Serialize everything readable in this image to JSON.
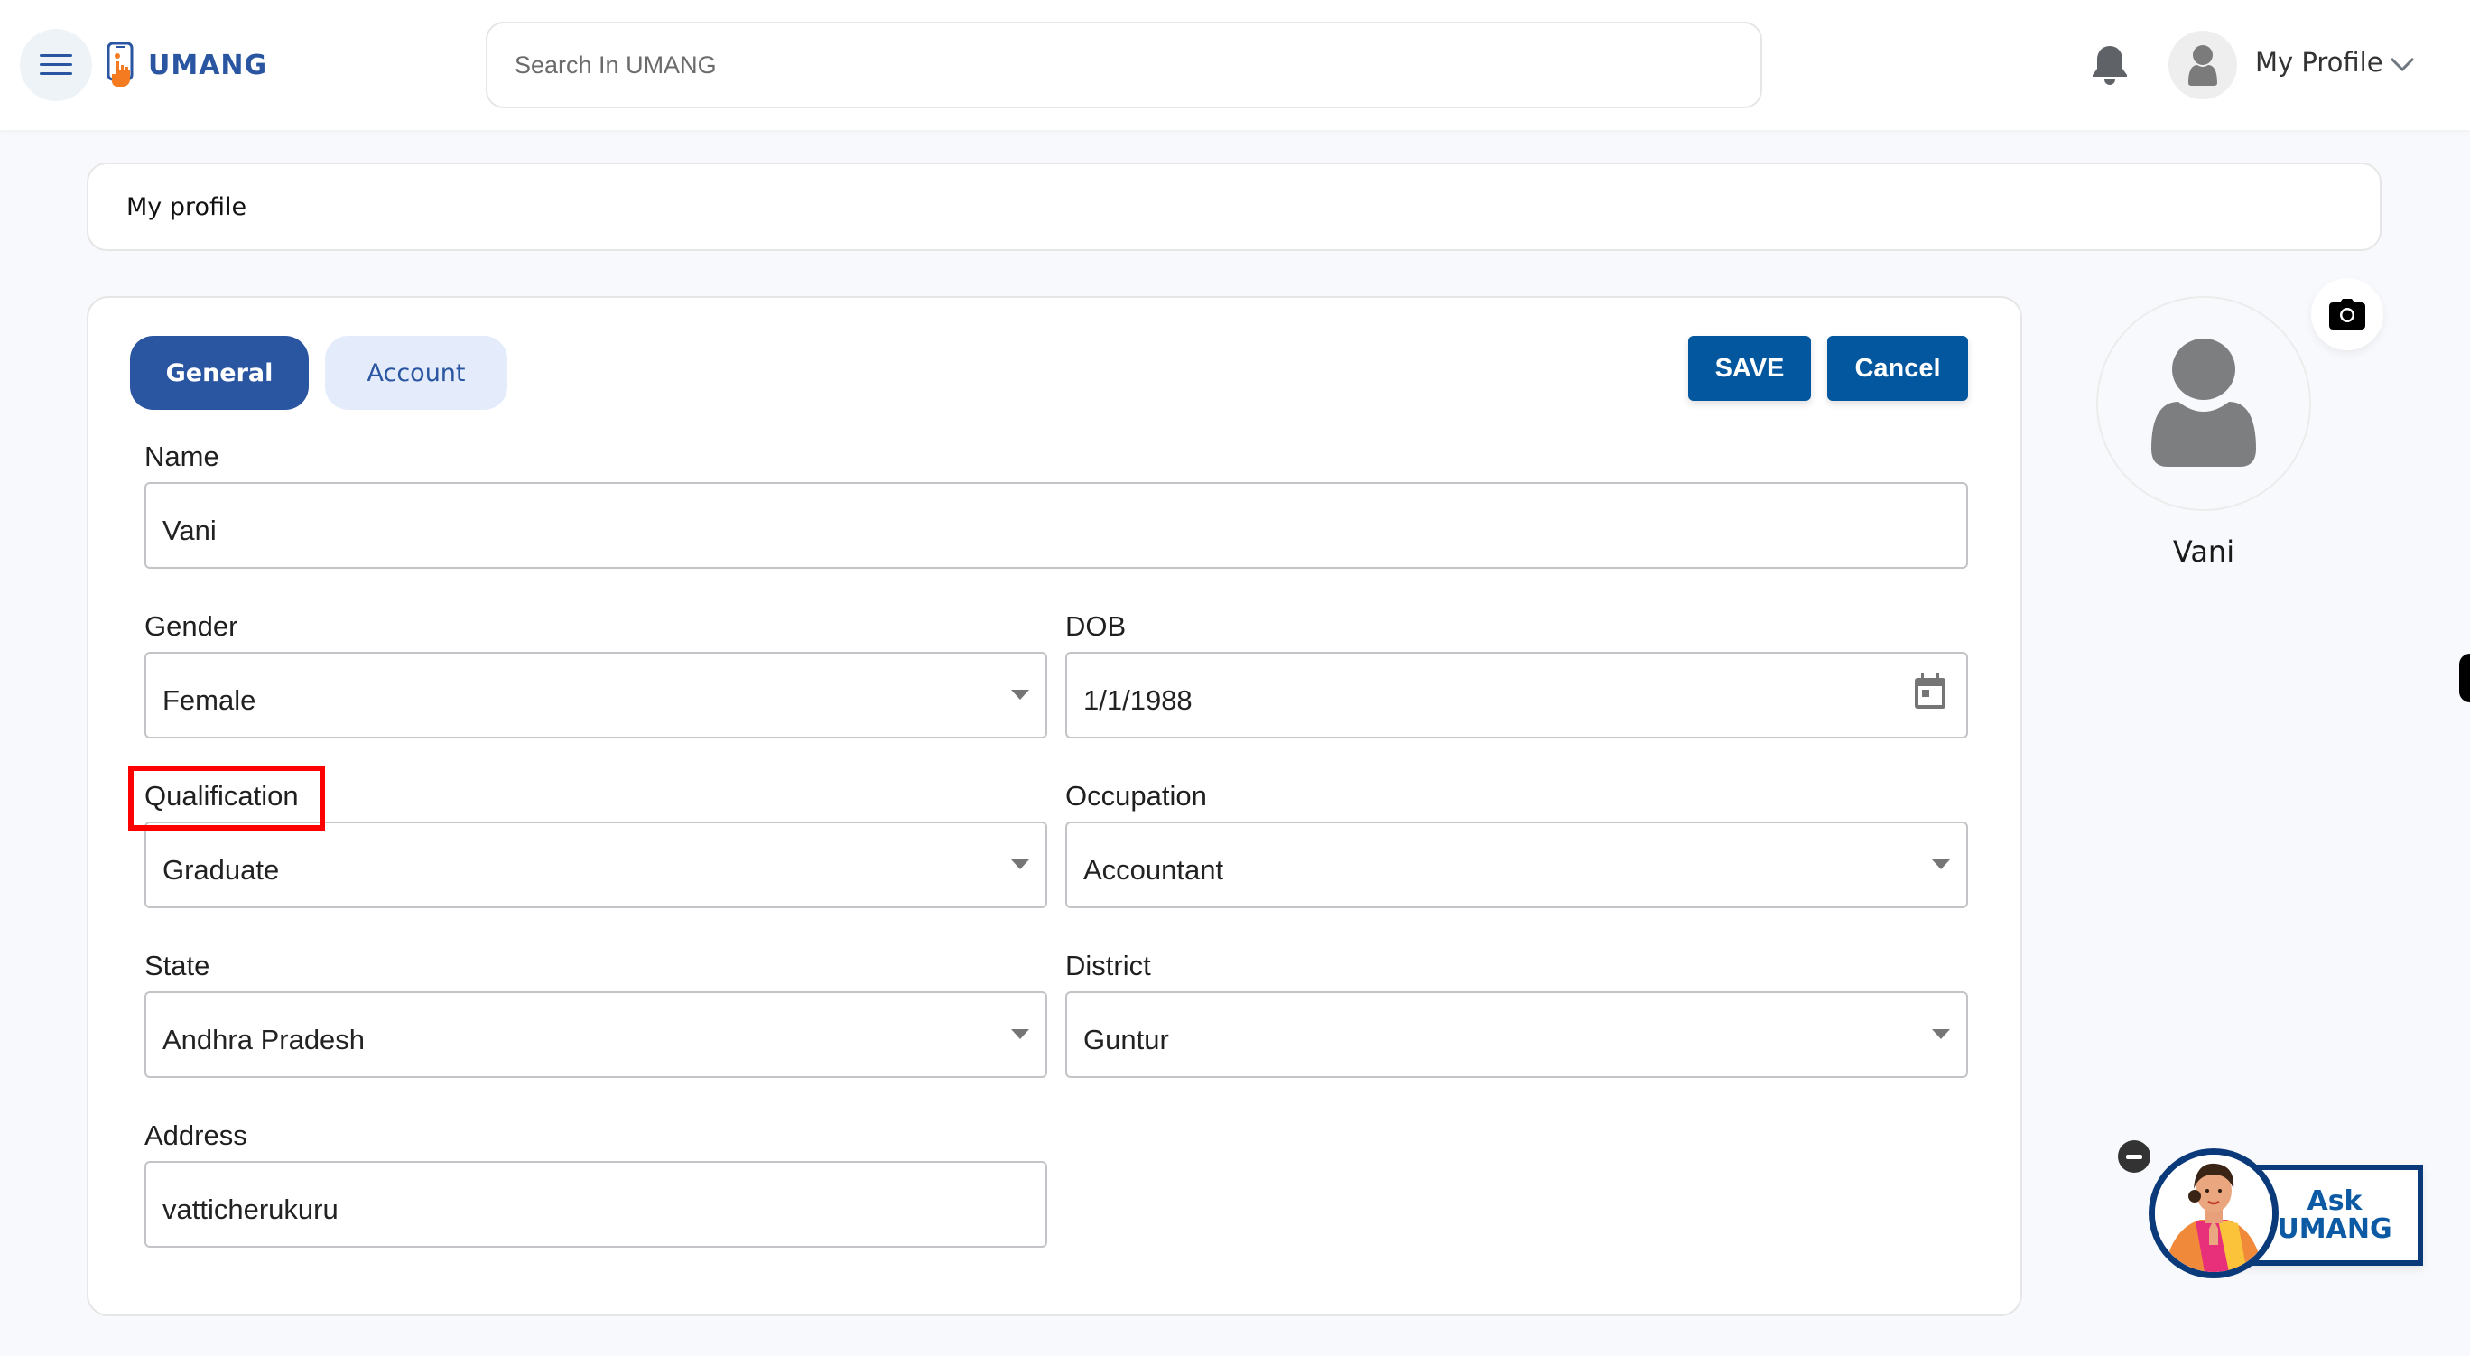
{
  "header": {
    "logo_text": "UMANG",
    "search_placeholder": "Search In UMANG",
    "search_value": "",
    "profile_label": "My Profile"
  },
  "breadcrumb": {
    "title": "My profile"
  },
  "tabs": [
    {
      "label": "General",
      "active": true
    },
    {
      "label": "Account",
      "active": false
    }
  ],
  "actions": {
    "save_label": "SAVE",
    "cancel_label": "Cancel"
  },
  "form": {
    "name": {
      "label": "Name",
      "value": "Vani"
    },
    "gender": {
      "label": "Gender",
      "value": "Female"
    },
    "dob": {
      "label": "DOB",
      "value": "1/1/1988"
    },
    "qualification": {
      "label": "Qualification",
      "value": "Graduate"
    },
    "occupation": {
      "label": "Occupation",
      "value": "Accountant"
    },
    "state": {
      "label": "State",
      "value": "Andhra Pradesh"
    },
    "district": {
      "label": "District",
      "value": "Guntur"
    },
    "address": {
      "label": "Address",
      "value": "vatticherukuru"
    }
  },
  "side_profile": {
    "name": "Vani"
  },
  "ask_widget": {
    "line1": "Ask",
    "line2": "UMANG"
  },
  "colors": {
    "brand_blue": "#2a56a1",
    "button_blue": "#02579e",
    "accent_orange": "#f47b20",
    "highlight_red": "#ff0000"
  }
}
